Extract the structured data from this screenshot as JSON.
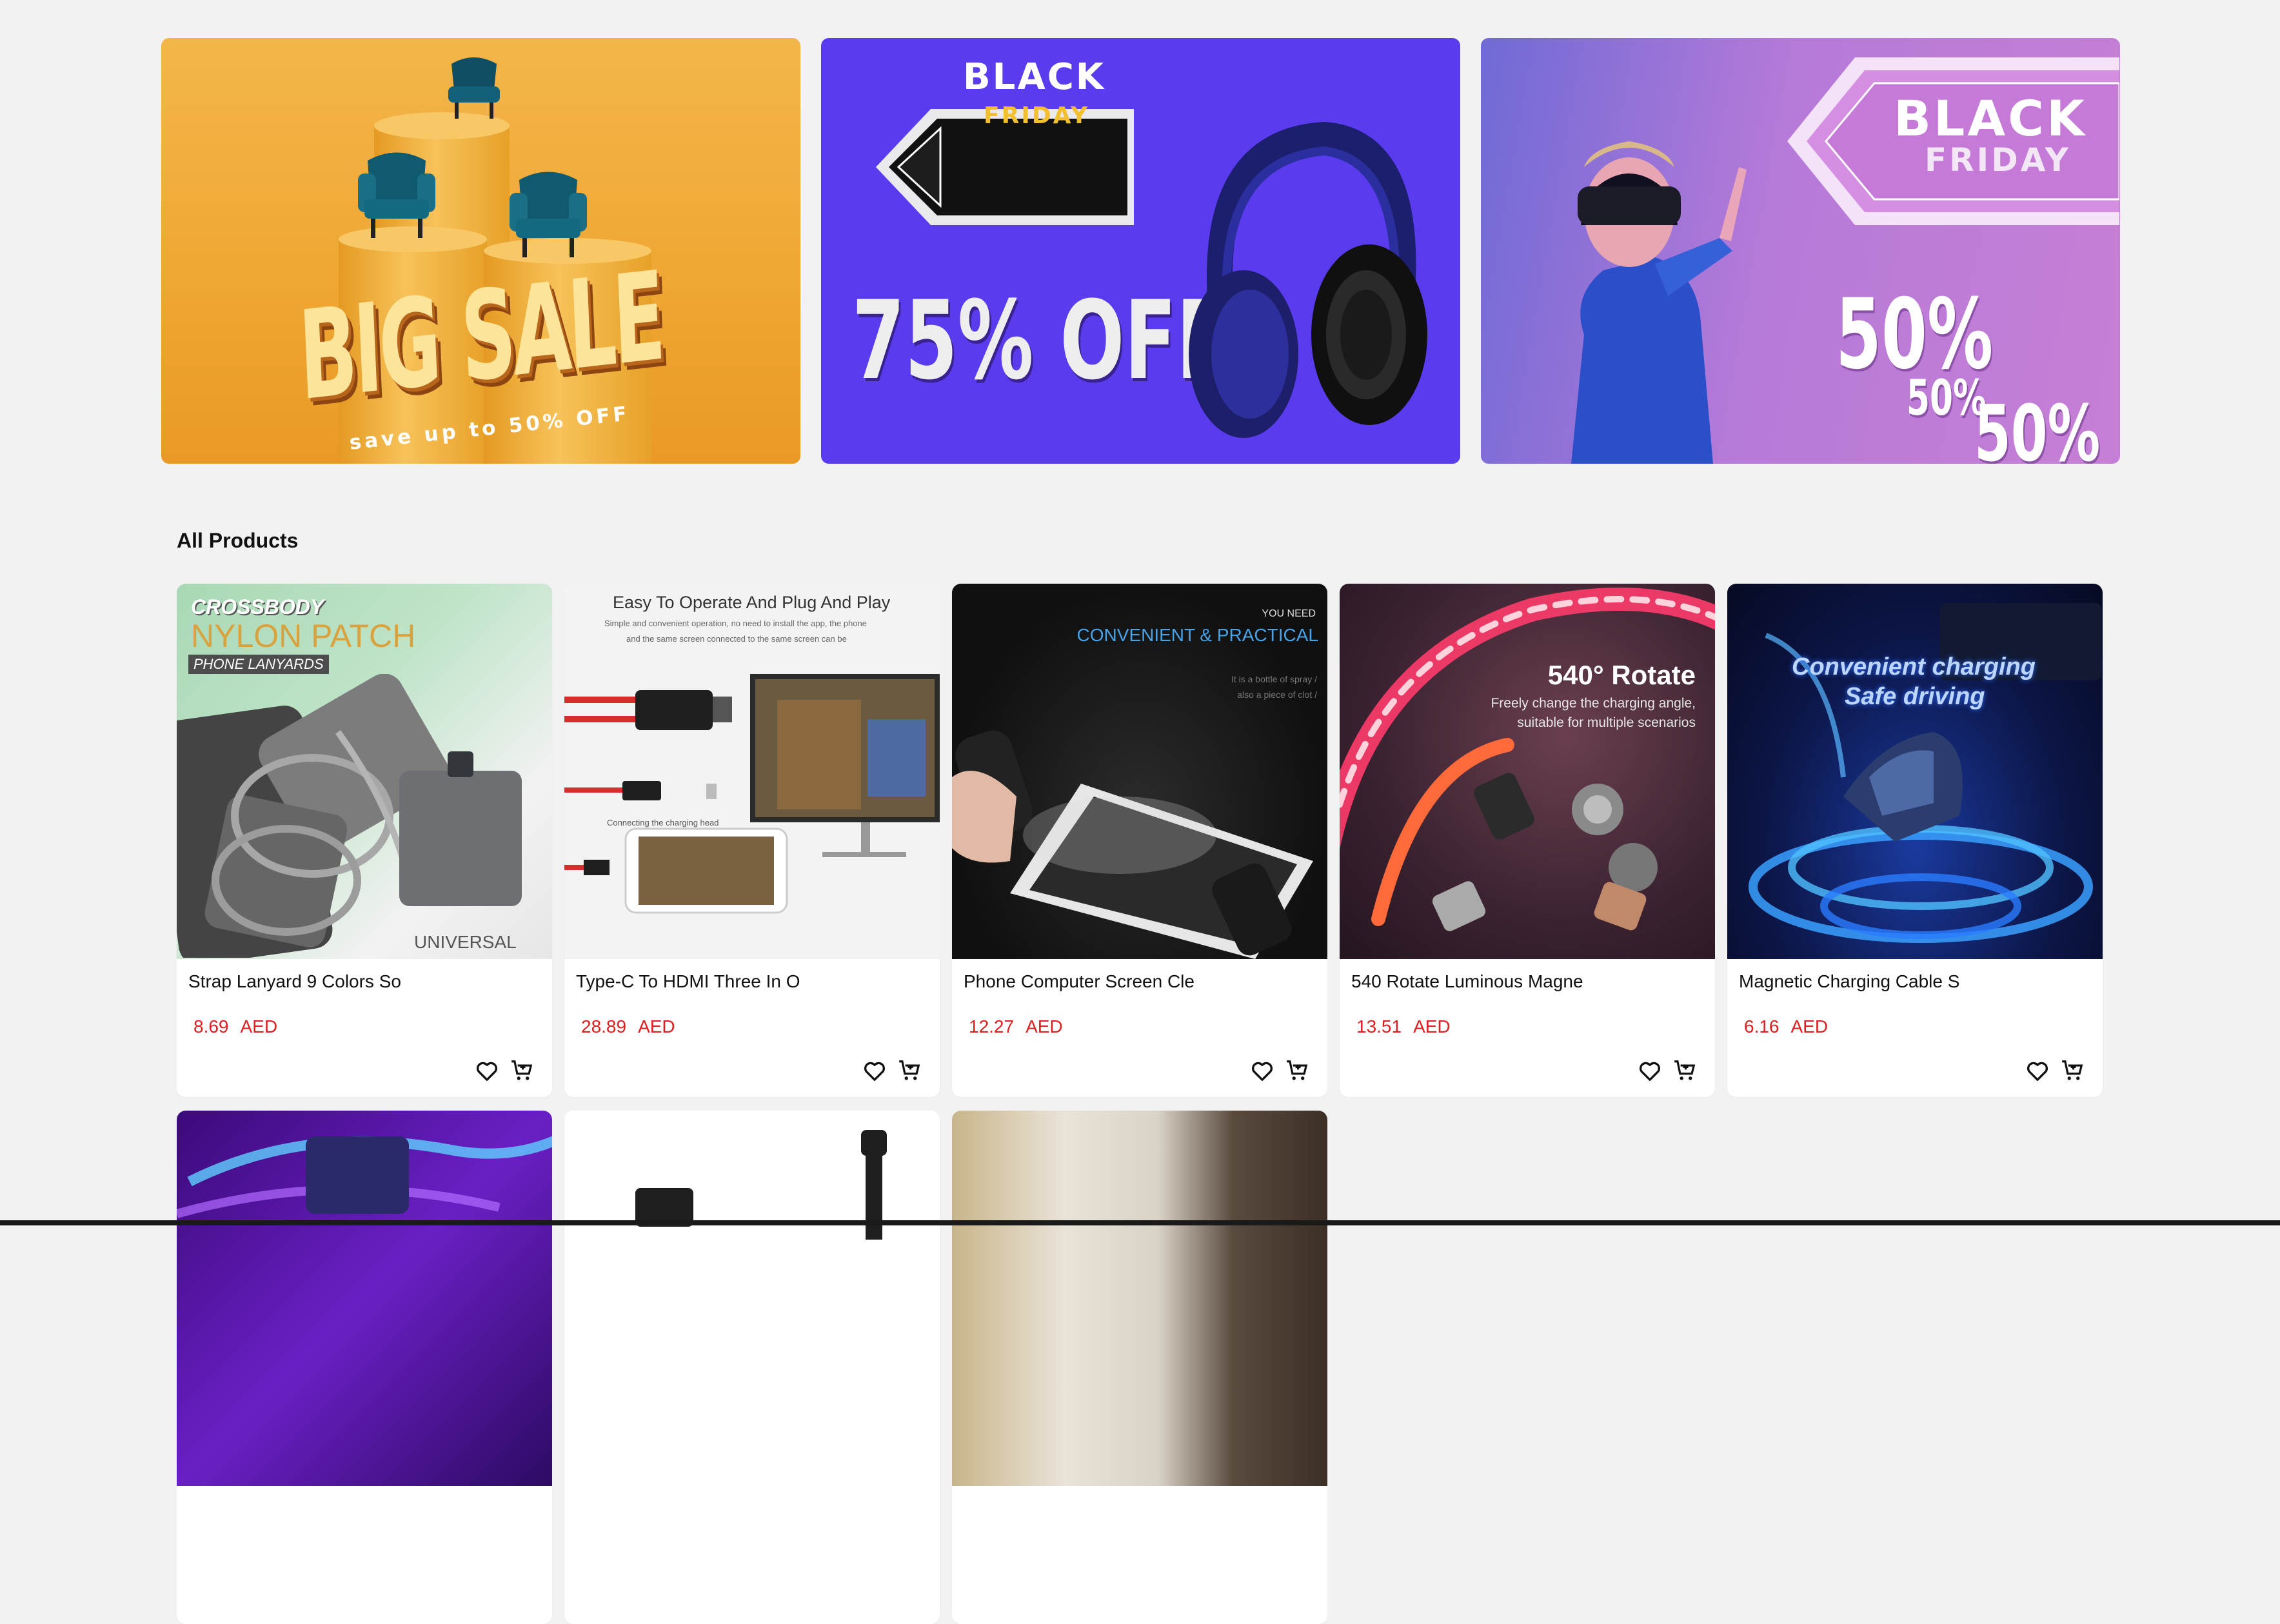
{
  "banners": {
    "banner1": {
      "headline": "BIG SALE",
      "subline": "save up to 50% OFF"
    },
    "banner2": {
      "tag_top": "BLACK",
      "tag_bottom": "FRIDAY",
      "headline": "75% OFF"
    },
    "banner3": {
      "tag_top": "BLACK",
      "tag_bottom": "FRIDAY",
      "pct1": "50%",
      "pct2": "50%",
      "pct3": "50%"
    }
  },
  "section": {
    "title": "All Products"
  },
  "products": [
    {
      "name": "Strap Lanyard 9 Colors So",
      "price": "8.69",
      "currency": "AED",
      "image_text": {
        "line1": "CROSSBODY",
        "line2": "NYLON PATCH",
        "line3": "PHONE LANYARDS",
        "line4": "UNIVERSAL"
      }
    },
    {
      "name": "Type-C To HDMI Three In O",
      "price": "28.89",
      "currency": "AED",
      "image_text": {
        "line1": "Easy To Operate And Plug And Play",
        "line2": "Simple and convenient operation, no need to install the app, the phone",
        "line3": "and the same screen connected to the same screen can be",
        "line4": "Connecting the charging head"
      }
    },
    {
      "name": "Phone Computer Screen Cle",
      "price": "12.27",
      "currency": "AED",
      "image_text": {
        "line1": "YOU NEED",
        "line2": "CONVENIENT & PRACTICAL",
        "line3": "It is a bottle of spray /",
        "line4": "also a piece of clot /"
      }
    },
    {
      "name": "540 Rotate Luminous Magne",
      "price": "13.51",
      "currency": "AED",
      "image_text": {
        "line1": "540° Rotate",
        "line2": "Freely change the charging angle,",
        "line3": "suitable for multiple scenarios"
      }
    },
    {
      "name": "Magnetic Charging Cable S",
      "price": "6.16",
      "currency": "AED",
      "image_text": {
        "line1": "Convenient charging",
        "line2": "Safe driving"
      }
    }
  ],
  "icons": {
    "wishlist": "heart-icon",
    "cart": "add-to-cart-icon"
  },
  "colors": {
    "price": "#e01e1e",
    "page_bg": "#f2f2f2",
    "banner2_bg": "#5a3bee"
  }
}
